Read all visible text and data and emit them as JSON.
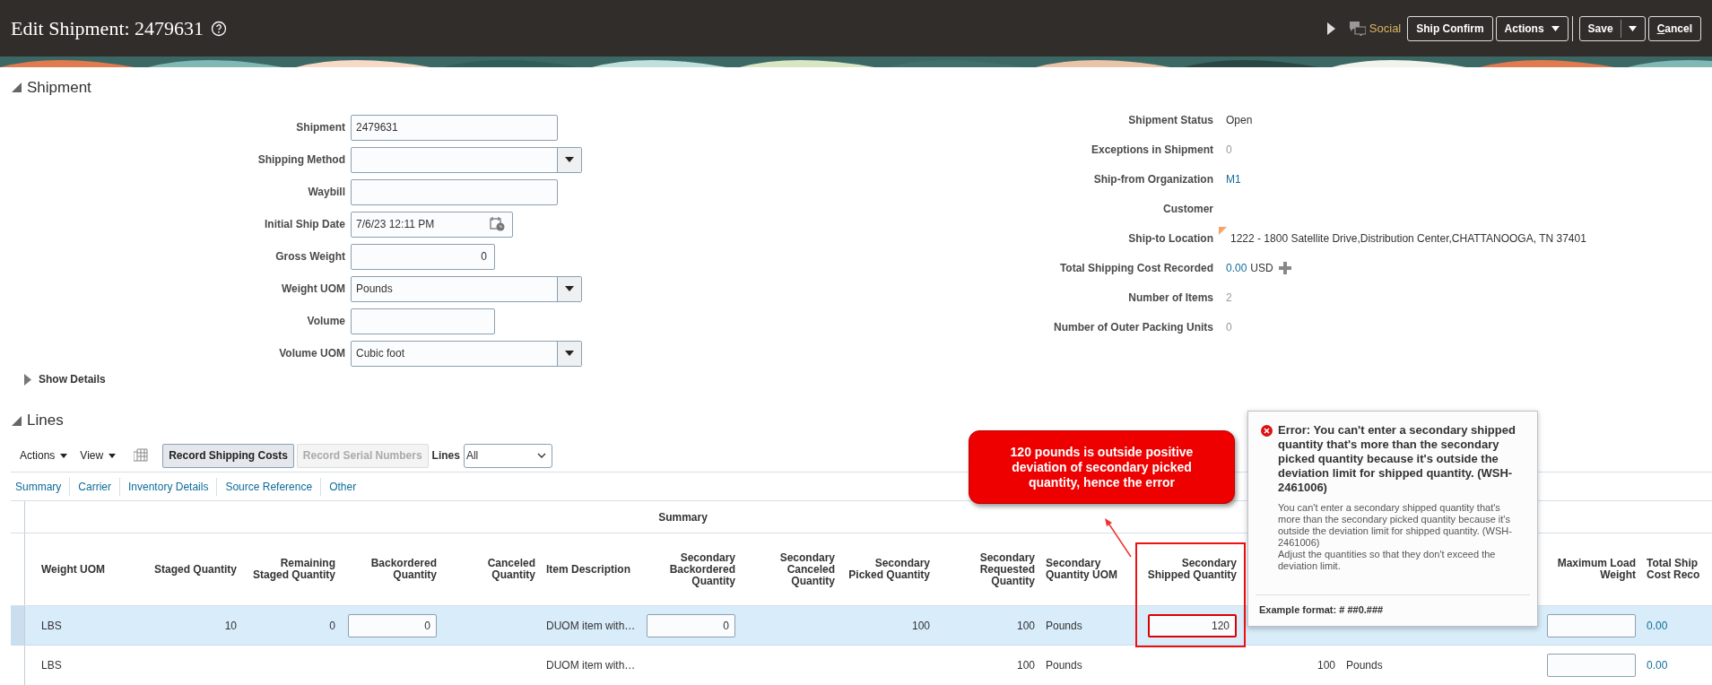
{
  "header": {
    "title": "Edit Shipment: 2479631",
    "social": "Social",
    "buttons": [
      {
        "label": "Ship Confirm",
        "kind": "button",
        "mnemonic_underline": false
      },
      {
        "label": "Actions",
        "kind": "menu",
        "mnemonic_underline": false
      },
      {
        "label": "Save",
        "kind": "split",
        "mnemonic_underline": false
      },
      {
        "label": "Cancel",
        "kind": "button",
        "mnemonic_underline": true
      }
    ]
  },
  "shipment": {
    "title": "Shipment",
    "expanded": true,
    "fields_left": [
      {
        "label": "Shipment",
        "kind": "text",
        "value": "2479631"
      },
      {
        "label": "Shipping Method",
        "kind": "select"
      },
      {
        "label": "Waybill",
        "kind": "text"
      },
      {
        "label": "Initial Ship Date",
        "kind": "date",
        "value": "7/6/23 12:11 PM"
      },
      {
        "label": "Gross Weight",
        "kind": "number",
        "value": "0"
      },
      {
        "label": "Weight UOM",
        "kind": "select",
        "value": "Pounds"
      },
      {
        "label": "Volume",
        "kind": "number"
      },
      {
        "label": "Volume UOM",
        "kind": "select",
        "value": "Cubic foot"
      }
    ],
    "fields_right": [
      {
        "label": "Shipment Status",
        "kind": "text",
        "value": "Open"
      },
      {
        "label": "Exceptions in Shipment",
        "kind": "muted",
        "value": "0"
      },
      {
        "label": "Ship-from Organization",
        "kind": "link",
        "value": "M1"
      },
      {
        "label": "Customer",
        "kind": "text"
      },
      {
        "label": "Ship-to Location",
        "kind": "location",
        "value": "1222 - 1800 Satellite Drive,Distribution Center,CHATTANOOGA, TN 37401"
      },
      {
        "label": "Total Shipping Cost Recorded",
        "kind": "amount",
        "value": "0.00",
        "currency": "USD"
      },
      {
        "label": "Number of Items",
        "kind": "muted",
        "value": "2"
      },
      {
        "label": "Number of Outer Packing Units",
        "kind": "muted",
        "value": "0"
      }
    ],
    "show_details": {
      "label": "Show Details",
      "expanded": false
    }
  },
  "lines": {
    "title": "Lines",
    "expanded": true,
    "menus": [
      "Actions",
      "View"
    ],
    "buttons": [
      {
        "label": "Record Shipping Costs",
        "disabled": false
      },
      {
        "label": "Record Serial Numbers",
        "disabled": true
      }
    ],
    "filter": {
      "label": "Lines",
      "value": "All"
    },
    "links": [
      "Summary",
      "Carrier",
      "Inventory Details",
      "Source Reference",
      "Other"
    ],
    "table": {
      "group_header": "Summary",
      "columns": [
        {
          "label": "Weight UOM"
        },
        {
          "label": "Staged Quantity"
        },
        {
          "label": "Remaining Staged Quantity"
        },
        {
          "label": "Backordered Quantity"
        },
        {
          "label": "Canceled Quantity"
        },
        {
          "label": "Item Description"
        },
        {
          "label": "Secondary Backordered Quantity"
        },
        {
          "label": "Secondary Canceled Quantity"
        },
        {
          "label": "Secondary Picked Quantity"
        },
        {
          "label": "Secondary Requested Quantity"
        },
        {
          "label": "Secondary Quantity UOM"
        },
        {
          "label": "Secondary Shipped Quantity"
        },
        {},
        {},
        {},
        {
          "label": "Maximum Load Weight"
        },
        {
          "label": "Total Ship Cost Reco"
        }
      ],
      "rows": [
        {
          "selected": true,
          "cells": [
            {
              "kind": "text",
              "value": "LBS"
            },
            {
              "kind": "text",
              "value": "10"
            },
            {
              "kind": "text",
              "value": "0"
            },
            {
              "kind": "input",
              "value": "0",
              "error": false
            },
            null,
            {
              "kind": "text",
              "value": "DUOM item with…"
            },
            {
              "kind": "input",
              "value": "0",
              "error": false
            },
            null,
            {
              "kind": "text",
              "value": "100"
            },
            {
              "kind": "text",
              "value": "100"
            },
            {
              "kind": "text",
              "value": "Pounds"
            },
            {
              "kind": "input",
              "value": "120",
              "error": true
            },
            null,
            null,
            null,
            {
              "kind": "input",
              "error": false
            },
            {
              "kind": "link",
              "value": "0.00"
            }
          ]
        },
        {
          "selected": false,
          "cells": [
            {
              "kind": "text",
              "value": "LBS"
            },
            null,
            null,
            null,
            null,
            {
              "kind": "text",
              "value": "DUOM item with…"
            },
            null,
            null,
            null,
            {
              "kind": "text",
              "value": "100"
            },
            {
              "kind": "text",
              "value": "Pounds"
            },
            null,
            {
              "kind": "text",
              "value": "100"
            },
            {
              "kind": "text",
              "value": "Pounds"
            },
            null,
            {
              "kind": "input",
              "error": false
            },
            {
              "kind": "link",
              "value": "0.00"
            }
          ]
        }
      ]
    }
  },
  "callout": "120 pounds is outside positive deviation of secondary picked quantity, hence the error",
  "error_popup": {
    "title": "Error: You can't enter a secondary shipped quantity that's more than the secondary picked quantity because it's outside the deviation limit for shipped quantity. (WSH-2461006)",
    "body": [
      "You can't enter a secondary shipped quantity that's more than the secondary picked quantity because it's outside the deviation limit for shipped quantity. (WSH-2461006)",
      "Adjust the quantities so that they don't exceed the deviation limit."
    ],
    "example": "Example format: # ##0.###"
  }
}
